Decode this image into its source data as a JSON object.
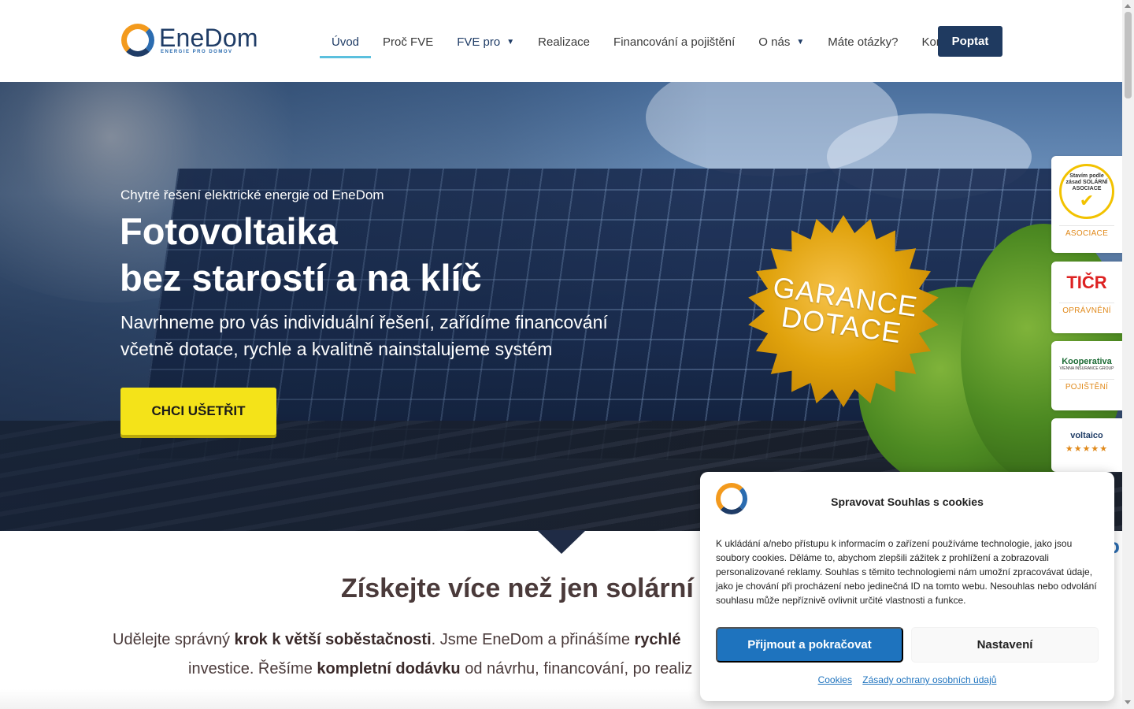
{
  "brand": {
    "name": "EneDom",
    "tagline": "ENERGIE PRO DOMOV"
  },
  "nav": {
    "items": [
      {
        "label": "Úvod",
        "active": true
      },
      {
        "label": "Proč FVE"
      },
      {
        "label": "FVE pro",
        "dropdown": true
      },
      {
        "label": "Realizace"
      },
      {
        "label": "Financování a pojištění"
      },
      {
        "label": "O nás",
        "dropdown": true
      },
      {
        "label": "Máte otázky?"
      },
      {
        "label": "Kontakt"
      }
    ],
    "cta": "Poptat"
  },
  "hero": {
    "pre_title": "Chytré řešení elektrické energie od EneDom",
    "title_line1": "Fotovoltaika",
    "title_line2": "bez starostí a na klíč",
    "subtitle_line1": "Navrhneme pro vás individuální řešení, zařídíme financování",
    "subtitle_line2": "včetně dotace, rychle a kvalitně nainstalujeme systém",
    "button": "CHCI UŠETŘIT",
    "badge_line1": "GARANCE",
    "badge_line2": "DOTACE"
  },
  "side_badges": [
    {
      "seal_text": "Stavím podle zásad SOLÁRNÍ ASOCIACE",
      "label": "ASOCIACE"
    },
    {
      "logo": "TIČR",
      "label": "OPRÁVNĚNÍ"
    },
    {
      "logo": "Kooperativa",
      "logo_sub": "VIENNA INSURANCE GROUP",
      "label": "POJIŠTĚNÍ"
    },
    {
      "logo": "voltaico",
      "rating": "★★★★★"
    }
  ],
  "section": {
    "title": "Získejte více než jen solární s",
    "p1_a": "Udělejte správný ",
    "p1_b": "krok k větší soběstačnosti",
    "p1_c": ". Jsme EneDom a přinášíme ",
    "p1_d": "rychlé",
    "p2_a": "investice. Řešíme ",
    "p2_b": "kompletní dodávku",
    "p2_c": " od návrhu, financování, po realiz"
  },
  "cookie": {
    "title": "Spravovat Souhlas s cookies",
    "text": "K ukládání a/nebo přístupu k informacím o zařízení používáme technologie, jako jsou soubory cookies. Děláme to, abychom zlepšili zážitek z prohlížení a zobrazovali personalizované reklamy. Souhlas s těmito technologiemi nám umožní zpracovávat údaje, jako je chování při procházení nebo jedinečná ID na tomto webu. Nesouhlas nebo odvolání souhlasu může nepříznivě ovlivnit určité vlastnosti a funkce.",
    "accept": "Přijmout a pokračovat",
    "settings": "Nastavení",
    "link_cookies": "Cookies",
    "link_privacy": "Zásady ochrany osobních údajů"
  },
  "colors": {
    "brand_dark": "#1f3a60",
    "brand_orange": "#f39a1d",
    "cta_yellow": "#f4e319",
    "accept_blue": "#1e73be"
  }
}
